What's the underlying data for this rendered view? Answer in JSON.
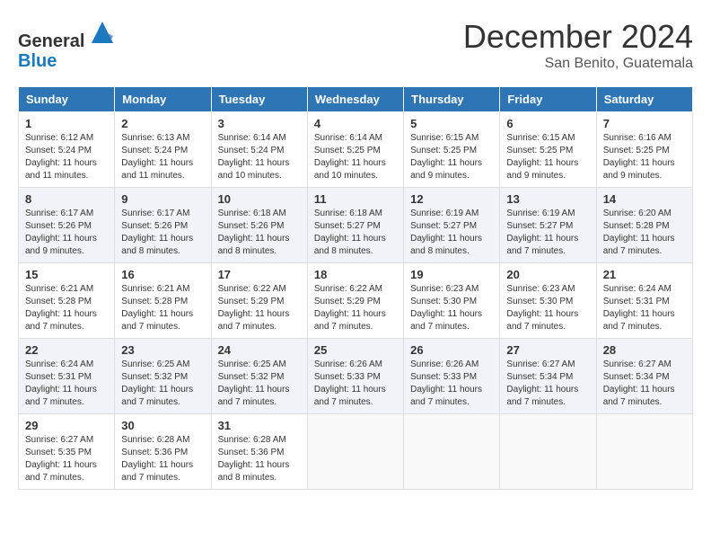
{
  "header": {
    "logo_general": "General",
    "logo_blue": "Blue",
    "month_title": "December 2024",
    "subtitle": "San Benito, Guatemala"
  },
  "days_of_week": [
    "Sunday",
    "Monday",
    "Tuesday",
    "Wednesday",
    "Thursday",
    "Friday",
    "Saturday"
  ],
  "weeks": [
    [
      {
        "day": "1",
        "sunrise": "6:12 AM",
        "sunset": "5:24 PM",
        "daylight": "11 hours and 11 minutes."
      },
      {
        "day": "2",
        "sunrise": "6:13 AM",
        "sunset": "5:24 PM",
        "daylight": "11 hours and 11 minutes."
      },
      {
        "day": "3",
        "sunrise": "6:14 AM",
        "sunset": "5:24 PM",
        "daylight": "11 hours and 10 minutes."
      },
      {
        "day": "4",
        "sunrise": "6:14 AM",
        "sunset": "5:25 PM",
        "daylight": "11 hours and 10 minutes."
      },
      {
        "day": "5",
        "sunrise": "6:15 AM",
        "sunset": "5:25 PM",
        "daylight": "11 hours and 9 minutes."
      },
      {
        "day": "6",
        "sunrise": "6:15 AM",
        "sunset": "5:25 PM",
        "daylight": "11 hours and 9 minutes."
      },
      {
        "day": "7",
        "sunrise": "6:16 AM",
        "sunset": "5:25 PM",
        "daylight": "11 hours and 9 minutes."
      }
    ],
    [
      {
        "day": "8",
        "sunrise": "6:17 AM",
        "sunset": "5:26 PM",
        "daylight": "11 hours and 9 minutes."
      },
      {
        "day": "9",
        "sunrise": "6:17 AM",
        "sunset": "5:26 PM",
        "daylight": "11 hours and 8 minutes."
      },
      {
        "day": "10",
        "sunrise": "6:18 AM",
        "sunset": "5:26 PM",
        "daylight": "11 hours and 8 minutes."
      },
      {
        "day": "11",
        "sunrise": "6:18 AM",
        "sunset": "5:27 PM",
        "daylight": "11 hours and 8 minutes."
      },
      {
        "day": "12",
        "sunrise": "6:19 AM",
        "sunset": "5:27 PM",
        "daylight": "11 hours and 8 minutes."
      },
      {
        "day": "13",
        "sunrise": "6:19 AM",
        "sunset": "5:27 PM",
        "daylight": "11 hours and 7 minutes."
      },
      {
        "day": "14",
        "sunrise": "6:20 AM",
        "sunset": "5:28 PM",
        "daylight": "11 hours and 7 minutes."
      }
    ],
    [
      {
        "day": "15",
        "sunrise": "6:21 AM",
        "sunset": "5:28 PM",
        "daylight": "11 hours and 7 minutes."
      },
      {
        "day": "16",
        "sunrise": "6:21 AM",
        "sunset": "5:28 PM",
        "daylight": "11 hours and 7 minutes."
      },
      {
        "day": "17",
        "sunrise": "6:22 AM",
        "sunset": "5:29 PM",
        "daylight": "11 hours and 7 minutes."
      },
      {
        "day": "18",
        "sunrise": "6:22 AM",
        "sunset": "5:29 PM",
        "daylight": "11 hours and 7 minutes."
      },
      {
        "day": "19",
        "sunrise": "6:23 AM",
        "sunset": "5:30 PM",
        "daylight": "11 hours and 7 minutes."
      },
      {
        "day": "20",
        "sunrise": "6:23 AM",
        "sunset": "5:30 PM",
        "daylight": "11 hours and 7 minutes."
      },
      {
        "day": "21",
        "sunrise": "6:24 AM",
        "sunset": "5:31 PM",
        "daylight": "11 hours and 7 minutes."
      }
    ],
    [
      {
        "day": "22",
        "sunrise": "6:24 AM",
        "sunset": "5:31 PM",
        "daylight": "11 hours and 7 minutes."
      },
      {
        "day": "23",
        "sunrise": "6:25 AM",
        "sunset": "5:32 PM",
        "daylight": "11 hours and 7 minutes."
      },
      {
        "day": "24",
        "sunrise": "6:25 AM",
        "sunset": "5:32 PM",
        "daylight": "11 hours and 7 minutes."
      },
      {
        "day": "25",
        "sunrise": "6:26 AM",
        "sunset": "5:33 PM",
        "daylight": "11 hours and 7 minutes."
      },
      {
        "day": "26",
        "sunrise": "6:26 AM",
        "sunset": "5:33 PM",
        "daylight": "11 hours and 7 minutes."
      },
      {
        "day": "27",
        "sunrise": "6:27 AM",
        "sunset": "5:34 PM",
        "daylight": "11 hours and 7 minutes."
      },
      {
        "day": "28",
        "sunrise": "6:27 AM",
        "sunset": "5:34 PM",
        "daylight": "11 hours and 7 minutes."
      }
    ],
    [
      {
        "day": "29",
        "sunrise": "6:27 AM",
        "sunset": "5:35 PM",
        "daylight": "11 hours and 7 minutes."
      },
      {
        "day": "30",
        "sunrise": "6:28 AM",
        "sunset": "5:36 PM",
        "daylight": "11 hours and 7 minutes."
      },
      {
        "day": "31",
        "sunrise": "6:28 AM",
        "sunset": "5:36 PM",
        "daylight": "11 hours and 8 minutes."
      },
      null,
      null,
      null,
      null
    ]
  ],
  "labels": {
    "sunrise": "Sunrise:",
    "sunset": "Sunset:",
    "daylight": "Daylight:"
  }
}
